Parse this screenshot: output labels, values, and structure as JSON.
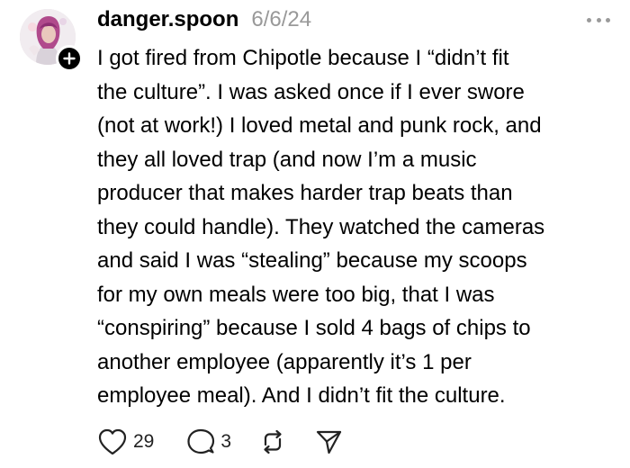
{
  "post": {
    "username": "danger.spoon",
    "timestamp": "6/6/24",
    "text": "I got fired from Chipotle because I “didn’t fit\nthe culture”. I was asked once if I ever swore\n(not at work!) I loved metal and punk rock, and\nthey all loved trap (and now I’m a music\nproducer that makes harder trap beats than\nthey could handle). They watched the cameras\nand said I was “stealing” because my scoops\nfor my own meals were too big, that I was\n“conspiring” because I sold 4 bags of chips to\nanother employee (apparently it’s 1 per\nemployee meal). And I didn’t fit the culture.",
    "likes": "29",
    "replies": "3"
  },
  "icons": {
    "avatar": "profile-photo",
    "follow": "plus-icon",
    "more": "more-dots-icon",
    "like": "heart-icon",
    "reply": "comment-bubble-icon",
    "repost": "repost-icon",
    "share": "send-icon"
  },
  "colors": {
    "text": "#000000",
    "muted": "#999999",
    "icon": "#222222"
  }
}
